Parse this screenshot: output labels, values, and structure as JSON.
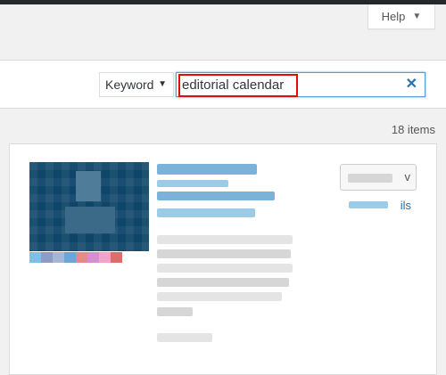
{
  "header": {
    "help_label": "Help",
    "help_caret": "▼"
  },
  "filter": {
    "type_label": "Keyword",
    "type_caret": "▼",
    "search_value": "editorial calendar",
    "clear_label": "✕"
  },
  "results": {
    "count_text": "18 items"
  },
  "plugin_card": {
    "install_label_fragment": "v",
    "details_label_fragment": "ils",
    "swatches": [
      "#7fbfe6",
      "#8d9bc6",
      "#a6b6d4",
      "#6ca6d6",
      "#e58989",
      "#d38fd2",
      "#f2a3c7",
      "#e06b6b"
    ]
  }
}
